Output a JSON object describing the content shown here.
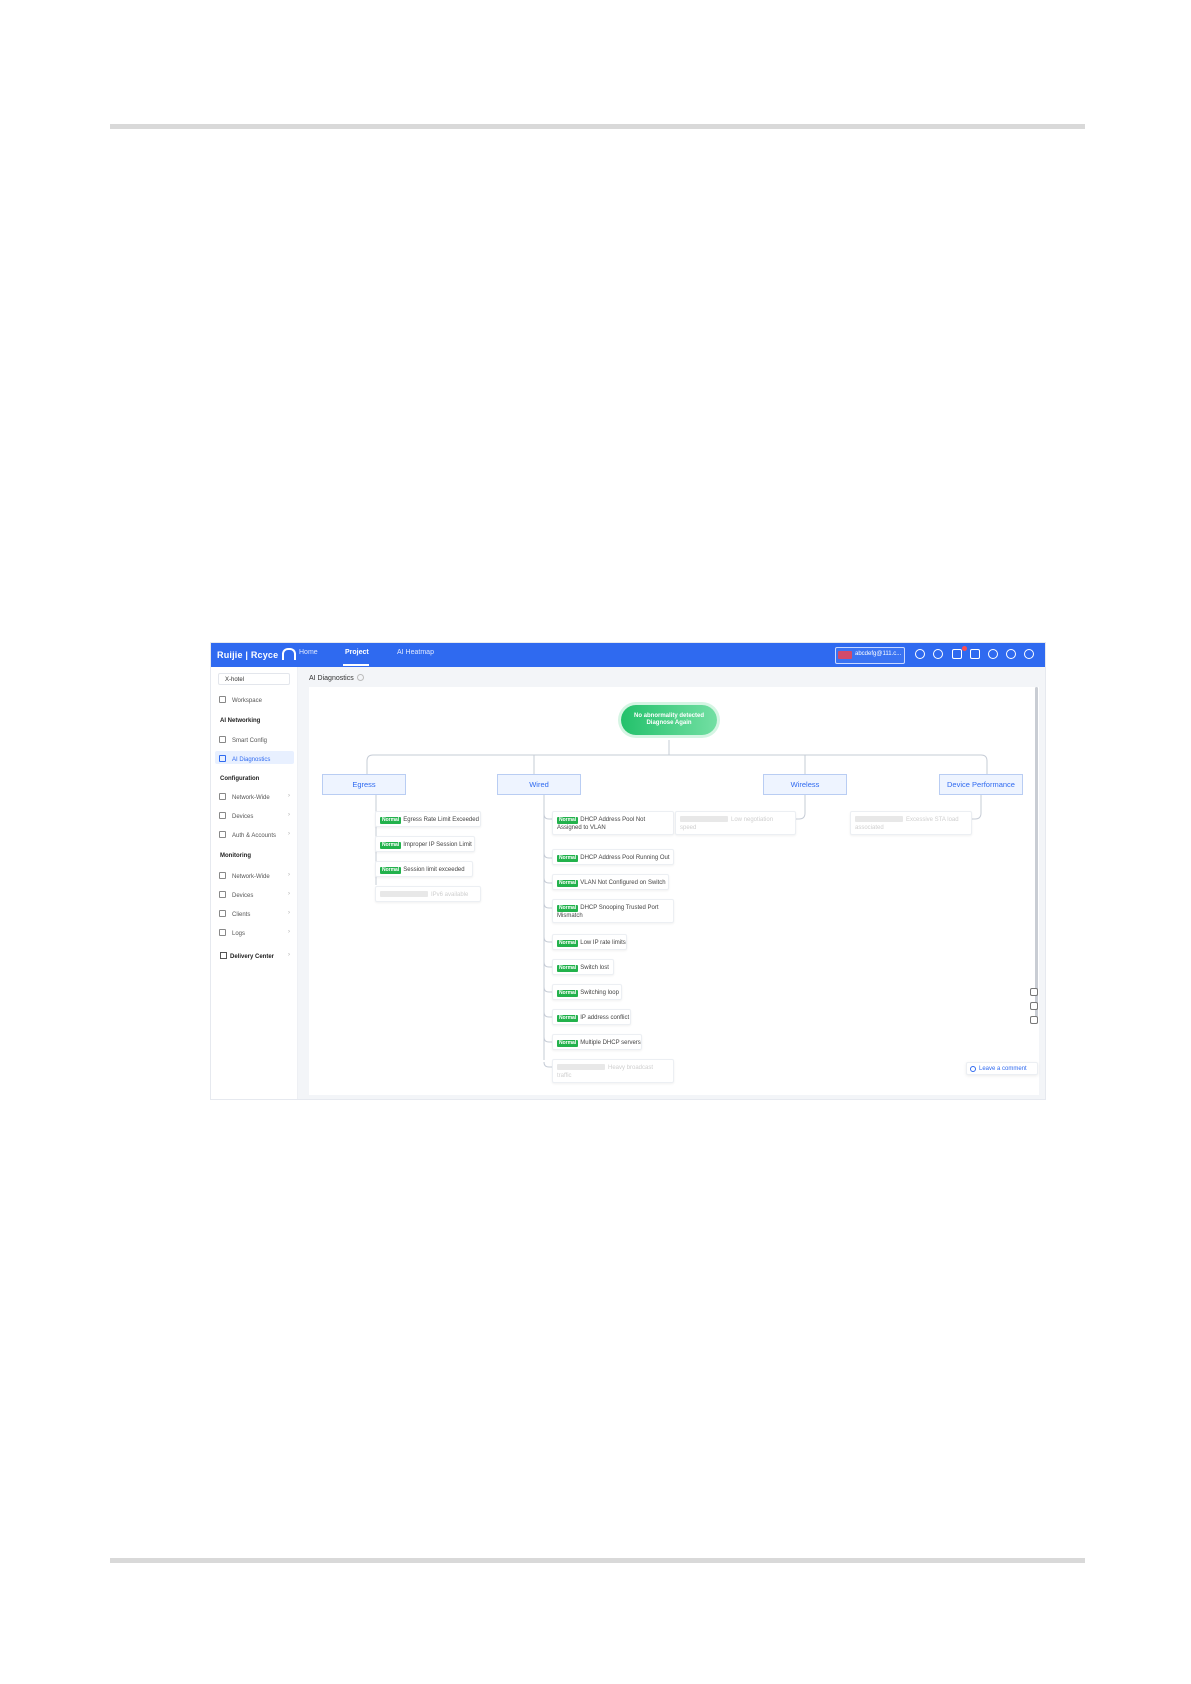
{
  "app": {
    "logo": "Ruijie | Rcyce",
    "nav": [
      "Home",
      "Project",
      "AI Heatmap"
    ],
    "active_nav": "Project",
    "account": "abcdefg@111.c...",
    "project_selector": "X-hotel"
  },
  "sidebar": {
    "workspace": "Workspace",
    "ai_networking_heading": "AI Networking",
    "smart_config": "Smart Config",
    "ai_diagnostics": "AI Diagnostics",
    "configuration_heading": "Configuration",
    "config_items": [
      "Network-Wide",
      "Devices",
      "Auth & Accounts"
    ],
    "monitoring_heading": "Monitoring",
    "monitoring_items": [
      "Network-Wide",
      "Devices",
      "Clients",
      "Logs"
    ],
    "delivery_center": "Delivery Center"
  },
  "page": {
    "title": "AI Diagnostics",
    "root_line1": "No abnormality detected",
    "root_line2": "Diagnose Again",
    "leave_comment": "Leave a comment"
  },
  "tree": {
    "categories": [
      "Egress",
      "Wired",
      "Wireless",
      "Device Performance"
    ],
    "status_label": "Normal",
    "egress": [
      "Egress Rate Limit Exceeded",
      "Improper IP Session Limit",
      "Session limit exceeded"
    ],
    "egress_ghost": "IPv6 available",
    "wired": [
      [
        "DHCP Address Pool Not",
        "Assigned to VLAN"
      ],
      [
        "DHCP Address Pool Running Out"
      ],
      [
        "VLAN Not Configured on Switch"
      ],
      [
        "DHCP Snooping Trusted Port",
        "Mismatch"
      ],
      [
        "Low IP rate limits"
      ],
      [
        "Switch lost"
      ],
      [
        "Switching loop"
      ],
      [
        "IP address conflict"
      ],
      [
        "Multiple DHCP servers"
      ]
    ],
    "wired_ghost": [
      "Heavy broadcast",
      "traffic"
    ],
    "wireless_ghost": [
      "Low negotiation",
      "speed"
    ],
    "device_ghost": [
      "Excessive STA load",
      "associated"
    ]
  }
}
